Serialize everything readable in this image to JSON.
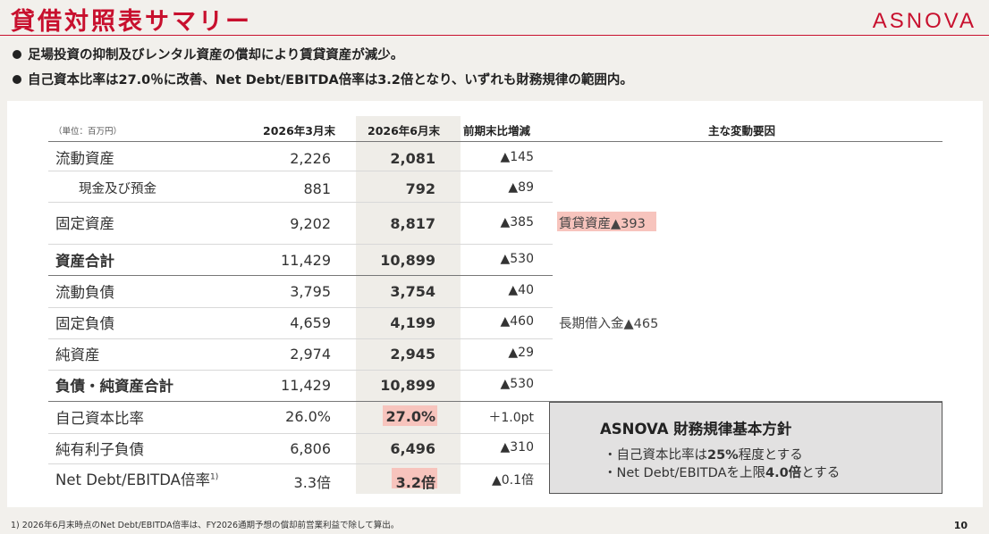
{
  "header": {
    "title": "貸借対照表サマリー",
    "logo": "ASNOVA"
  },
  "bullets": [
    "足場投資の抑制及びレンタル資産の償却により賃貸資産が減少。",
    "自己資本比率は27.0％に改善、Net Debt/EBITDA倍率は3.2倍となり、いずれも財務規律の範囲内。"
  ],
  "table": {
    "unit": "（単位：百万円）",
    "columns": {
      "prev": "2026年3月末",
      "curr": "2026年6月末",
      "change": "前期末比増減",
      "notes": "主な変動要因"
    },
    "rows": [
      {
        "label": "流動資産",
        "prev": "2,226",
        "curr": "2,081",
        "change": "▲145",
        "note": ""
      },
      {
        "label": "現金及び預金",
        "prev": "881",
        "curr": "792",
        "change": "▲89",
        "note": ""
      },
      {
        "label": "固定資産",
        "prev": "9,202",
        "curr": "8,817",
        "change": "▲385",
        "note": "賃貸資産▲393"
      },
      {
        "label": "資産合計",
        "prev": "11,429",
        "curr": "10,899",
        "change": "▲530",
        "note": ""
      },
      {
        "label": "流動負債",
        "prev": "3,795",
        "curr": "3,754",
        "change": "▲40",
        "note": ""
      },
      {
        "label": "固定負債",
        "prev": "4,659",
        "curr": "4,199",
        "change": "▲460",
        "note": "長期借入金▲465"
      },
      {
        "label": "純資産",
        "prev": "2,974",
        "curr": "2,945",
        "change": "▲29",
        "note": ""
      },
      {
        "label": "負債・純資産合計",
        "prev": "11,429",
        "curr": "10,899",
        "change": "▲530",
        "note": ""
      },
      {
        "label": "自己資本比率",
        "prev": "26.0%",
        "curr": "27.0%",
        "change": "＋1.0pt",
        "note": ""
      },
      {
        "label": "純有利子負債",
        "prev": "6,806",
        "curr": "6,496",
        "change": "▲310",
        "note": ""
      },
      {
        "label": "Net Debt/EBITDA倍率",
        "label_sup": "1)",
        "prev": "3.3倍",
        "curr": "3.2倍",
        "change": "▲0.1倍",
        "note": ""
      }
    ]
  },
  "policy": {
    "title": "ASNOVA 財務規律基本方針",
    "line1_pre": "・自己資本比率は",
    "line1_bold": "25%",
    "line1_post": "程度とする",
    "line2_pre": "・Net Debt/EBITDAを上限",
    "line2_bold": "4.0倍",
    "line2_post": "とする"
  },
  "footnote": "1) 2026年6月末時点のNet Debt/EBITDA倍率は、FY2026通期予想の償却前営業利益で除して算出。",
  "page_number": "10",
  "colors": {
    "brand": "#c8102e",
    "highlight": "#f7c4bd"
  }
}
